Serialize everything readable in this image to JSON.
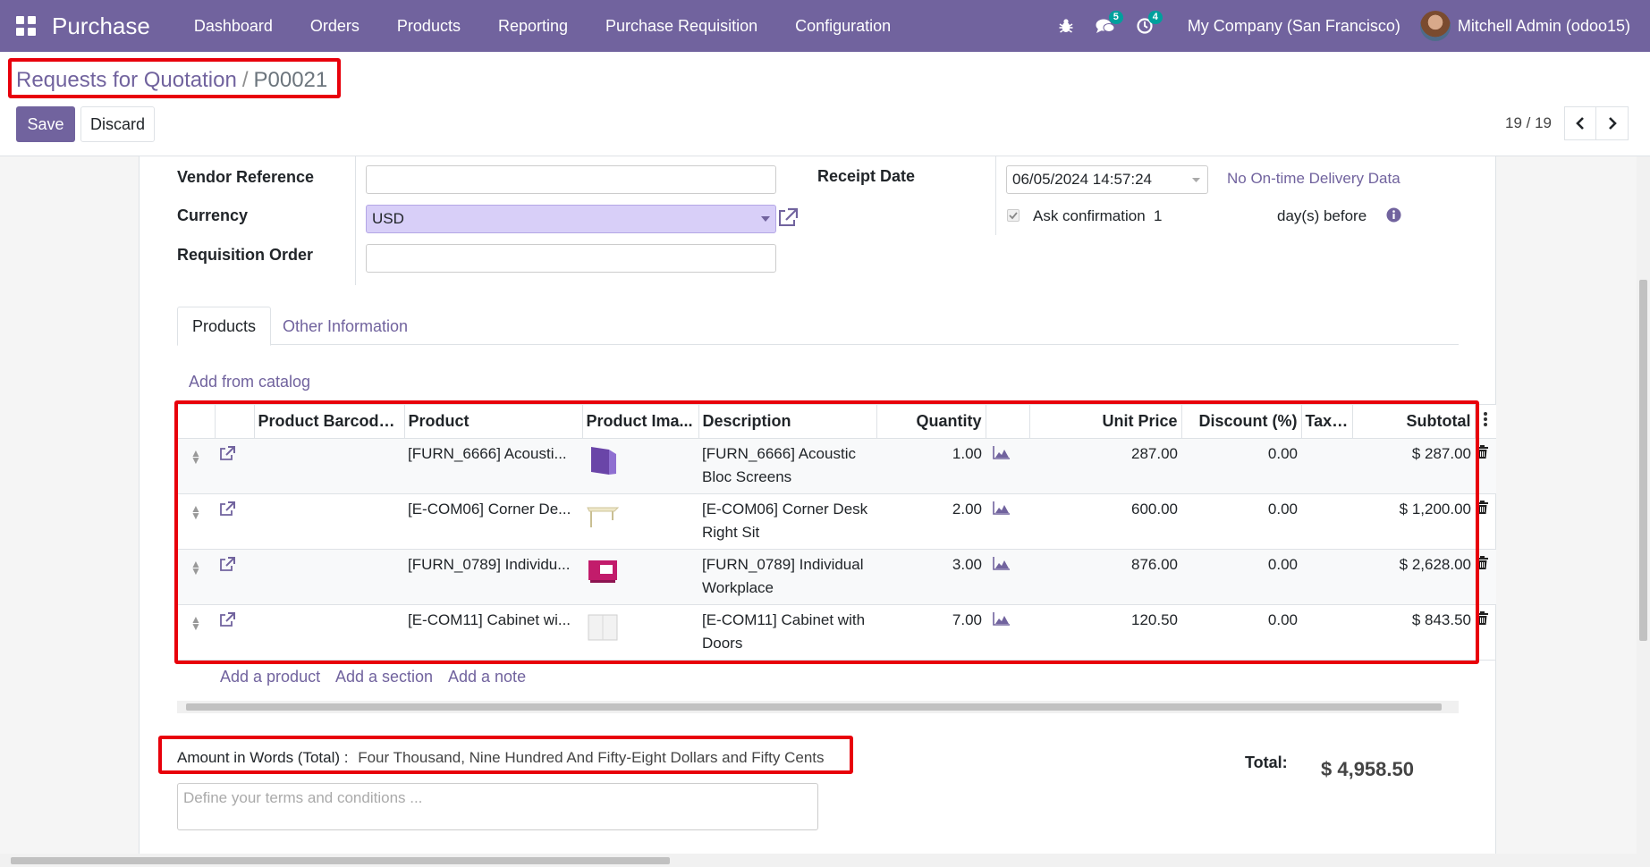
{
  "navbar": {
    "brand": "Purchase",
    "menu": [
      "Dashboard",
      "Orders",
      "Products",
      "Reporting",
      "Purchase Requisition",
      "Configuration"
    ],
    "messages_count": "5",
    "activities_count": "4",
    "company": "My Company (San Francisco)",
    "user": "Mitchell Admin (odoo15)"
  },
  "breadcrumb": {
    "parent": "Requests for Quotation",
    "sep": "/",
    "current": "P00021"
  },
  "buttons": {
    "save": "Save",
    "discard": "Discard"
  },
  "pager": {
    "value": "19 / 19"
  },
  "form": {
    "vendor_reference_label": "Vendor Reference",
    "vendor_reference_value": "",
    "currency_label": "Currency",
    "currency_value": "USD",
    "requisition_order_label": "Requisition Order",
    "requisition_order_value": "",
    "receipt_date_label": "Receipt Date",
    "receipt_date_value": "06/05/2024 14:57:24",
    "on_time_delivery": "No On-time Delivery Data",
    "ask_confirmation_label": "Ask confirmation",
    "ask_confirmation_value": "1",
    "days_before": "day(s) before"
  },
  "tabs": {
    "products": "Products",
    "other_info": "Other Information"
  },
  "add_from_catalog": "Add from catalog",
  "table": {
    "headers": {
      "barcode": "Product Barcode...",
      "product": "Product",
      "image": "Product Ima...",
      "description": "Description",
      "quantity": "Quantity",
      "unit_price": "Unit Price",
      "discount": "Discount (%)",
      "taxes": "Taxes",
      "subtotal": "Subtotal"
    },
    "rows": [
      {
        "product": "[FURN_6666] Acousti...",
        "desc1": "[FURN_6666] Acoustic",
        "desc2": "Bloc Screens",
        "qty": "1.00",
        "price": "287.00",
        "discount": "0.00",
        "subtotal": "$ 287.00"
      },
      {
        "product": "[E-COM06] Corner De...",
        "desc1": "[E-COM06] Corner Desk",
        "desc2": "Right Sit",
        "qty": "2.00",
        "price": "600.00",
        "discount": "0.00",
        "subtotal": "$ 1,200.00"
      },
      {
        "product": "[FURN_0789] Individu...",
        "desc1": "[FURN_0789] Individual",
        "desc2": "Workplace",
        "qty": "3.00",
        "price": "876.00",
        "discount": "0.00",
        "subtotal": "$ 2,628.00"
      },
      {
        "product": "[E-COM11] Cabinet wi...",
        "desc1": "[E-COM11] Cabinet with",
        "desc2": "Doors",
        "qty": "7.00",
        "price": "120.50",
        "discount": "0.00",
        "subtotal": "$ 843.50"
      }
    ]
  },
  "add_links": {
    "product": "Add a product",
    "section": "Add a section",
    "note": "Add a note"
  },
  "amount_words": {
    "label": "Amount in Words (Total) :",
    "value": "Four Thousand, Nine Hundred And Fifty-Eight Dollars and Fifty Cents"
  },
  "terms_placeholder": "Define your terms and conditions ...",
  "total": {
    "label": "Total:",
    "value": "$ 4,958.50"
  },
  "colors": {
    "primary": "#71639e",
    "annotation": "#e8000b",
    "badge": "#00a09d"
  }
}
